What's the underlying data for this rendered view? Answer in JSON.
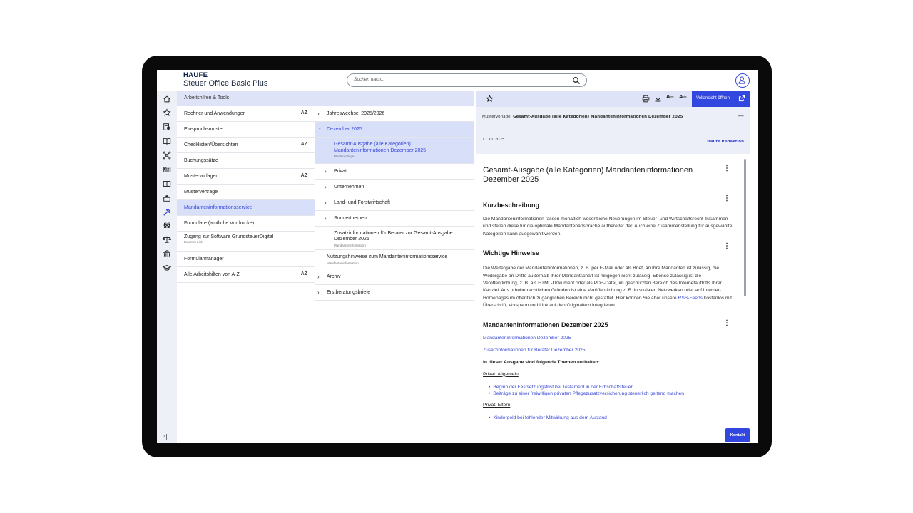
{
  "header": {
    "logo": "HAUFE",
    "product": "Steuer Office Basic Plus",
    "search_placeholder": "Suchen nach..."
  },
  "rail": {
    "icons": [
      "home-icon",
      "star-icon",
      "document-search-icon",
      "book-open-icon",
      "network-icon",
      "news-icon",
      "book-icon",
      "box-icon",
      "tools-icon",
      "paragraph-icon",
      "scale-icon",
      "bank-icon",
      "graduation-cap-icon"
    ],
    "active": "tools-icon",
    "collapse_label": "›|"
  },
  "nav": {
    "title": "Arbeitshilfen & Tools",
    "items": [
      {
        "label": "Rechner und Anwendungen",
        "az": "AZ"
      },
      {
        "label": "Einspruchsmuster"
      },
      {
        "label": "Checklisten/Übersichten",
        "az": "AZ"
      },
      {
        "label": "Buchungssätze"
      },
      {
        "label": "Mustervorlagen",
        "az": "AZ"
      },
      {
        "label": "Musterverträge"
      },
      {
        "label": "Mandanteninformationsservice"
      },
      {
        "label": "Formulare (amtliche Vordrucke)"
      },
      {
        "label": "Zugang zur Software GrundsteuerDigital",
        "sub": "Externer Link"
      },
      {
        "label": "Formularmanager"
      },
      {
        "label": "Alle Arbeitshilfen von A-Z",
        "az": "AZ"
      }
    ]
  },
  "middle": {
    "items": [
      {
        "label": "Jahreswechsel 2025/2026",
        "chev": "›"
      },
      {
        "label": "Dezember 2025",
        "chev": "⌄"
      },
      {
        "label": "Gesamt-Ausgabe (alle Kategorien) Mandanteninformationen Dezember 2025",
        "sub": "Mustervorlage"
      },
      {
        "label": "Privat",
        "chev": "›"
      },
      {
        "label": "Unternehmen",
        "chev": "›"
      },
      {
        "label": "Land- und Forstwirtschaft",
        "chev": "›"
      },
      {
        "label": "Sonderthemen",
        "chev": "›"
      },
      {
        "label": "Zusatzinformationen für Berater zur Gesamt-Ausgabe Dezember 2025",
        "sub": "Mandanteninformation"
      },
      {
        "label": "Nutzungshinweise zum Mandanteninformationsservice",
        "sub": "Mandanteninformation"
      },
      {
        "label": "Archiv",
        "chev": "›"
      },
      {
        "label": "Erstberatungsbriefe",
        "chev": "›"
      }
    ]
  },
  "document": {
    "toolbar": {
      "font_smaller": "A−",
      "font_larger": "A+",
      "open_full": "Vollansicht öffnen"
    },
    "meta": {
      "prefix": "Mustervorlage:",
      "title": "Gesamt-Ausgabe (alle Kategorien) Mandanteninformationen Dezember 2025",
      "date": "17.11.2025",
      "author": "Haufe Redaktion",
      "collapse": "—"
    },
    "title": "Gesamt-Ausgabe (alle Kategorien) Mandanteninformationen Dezember 2025",
    "sections": {
      "kurz_title": "Kurzbeschreibung",
      "kurz_text": "Die Mandanteninformationen fassen monatlich wesentliche Neuerungen im Steuer- und Wirtschaftsrecht zusammen und stellen diese für die optimale Mandantenansprache aufbereitet dar. Auch eine Zusammenstellung für ausgewählte Kategorien kann ausgewählt werden.",
      "hinweise_title": "Wichtige Hinweise",
      "hinweise_text_1": "Die Weitergabe der Mandanteninformationen, z. B. per E-Mail oder als Brief, an Ihre Mandanten ist zulässig, die Weitergabe an Dritte außerhalb Ihrer Mandantschaft ist hingegen nicht zulässig. Ebenso zulässig ist die Veröffentlichung, z. B. als HTML-Dokument oder als PDF-Datei, im geschützten Bereich des Internetauftritts Ihrer Kanzlei. Aus urheberrechtlichen Gründen ist eine Veröffentlichung z. B. in sozialen Netzwerken oder auf Internet-Homepages im öffentlich zugänglichen Bereich nicht gestattet. Hier können Sie aber unsere",
      "hinweise_link": "RSS-Feeds",
      "hinweise_text_2": "kostenlos mit Überschrift, Vorspann und Link auf den Originaltext integrieren.",
      "mi_title": "Mandanteninformationen Dezember 2025",
      "mi_link_1": "Mandanteninformationen Dezember 2025",
      "mi_link_2": "Zusatzinformationen für Berater Dezember 2025",
      "themen_intro": "In dieser Ausgabe sind folgende Themen enthalten:",
      "privat_allgemein": "Privat: Allgemein",
      "allgemein_items": [
        "Beginn der Festsetzungsfrist bei Testament in der Erbschaftsteuer",
        "Beiträge zu einer freiwilligen privaten Pflegezusatzversicherung steuerlich geltend machen"
      ],
      "privat_eltern": "Privat: Eltern",
      "eltern_items": [
        "Kindergeld bei fehlender Mitwirkung aus dem Ausland"
      ]
    },
    "contact": "Kontakt"
  }
}
